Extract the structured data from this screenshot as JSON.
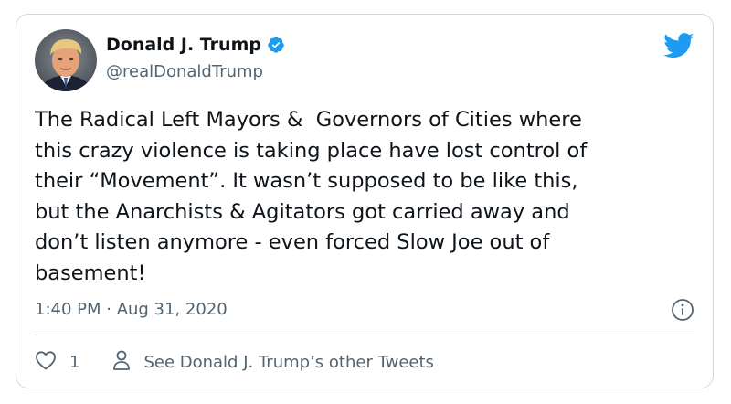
{
  "tweet": {
    "author": {
      "display_name": "Donald J. Trump",
      "handle": "@realDonaldTrump",
      "verified": true,
      "verified_icon": "verified-badge-icon",
      "avatar_icon": "avatar"
    },
    "text_lines": [
      "The Radical Left Mayors &  Governors of Cities where",
      "this crazy violence is taking place have lost control of",
      "their “Movement”. It wasn’t supposed to be like this,",
      "but the Anarchists & Agitators got carried away and",
      "don’t listen anymore - even forced Slow Joe out of",
      "basement!"
    ],
    "timestamp": "1:40 PM · Aug 31, 2020",
    "info_icon": "info-icon",
    "brand_icon": "twitter-bird-icon"
  },
  "actions": {
    "like_icon": "heart-icon",
    "like_count": "1",
    "profile_icon": "person-icon",
    "other_tweets_label": "See Donald J. Trump’s other Tweets"
  },
  "colors": {
    "twitter_blue": "#1d9bf0",
    "text_primary": "#0f1419",
    "text_secondary": "#536471",
    "border": "#cfd9de"
  }
}
